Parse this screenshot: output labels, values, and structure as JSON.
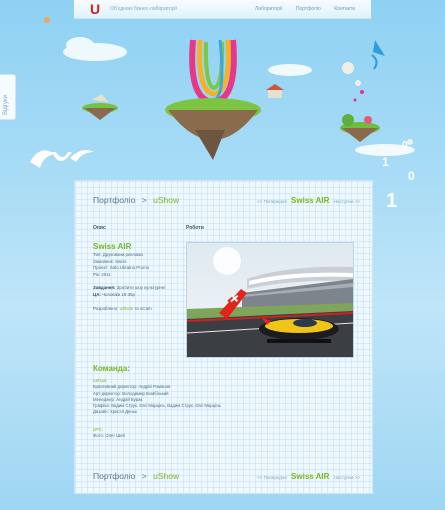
{
  "header": {
    "logo": "U",
    "tagline": "Об'єднані бізнес-лабораторії",
    "nav": [
      "Лабораторії",
      "Портфоліо",
      "Контакти"
    ]
  },
  "side_tab": {
    "label": "Відгуки"
  },
  "breadcrumb": {
    "parent": "Портфоліо",
    "separator": ">",
    "current": "uShow"
  },
  "pager": {
    "prev": "<< Попередня",
    "project": "Swiss AIR",
    "next": "Наступна >>"
  },
  "columns": {
    "description": "Опис",
    "work": "Роботи"
  },
  "project": {
    "title": "Swiss AIR",
    "details": [
      "Тип: Друкована реклама",
      "Замовник: Swiss",
      "Проект: Salo Ukraina Promo",
      "Рік: 2011"
    ],
    "task_label": "Завдання:",
    "task_text": "Зробити шоу культурне!",
    "ca_label": "ЦА:",
    "ca_text": "Чоловіки 18-35р",
    "developed_prefix": "Розроблено:",
    "developed_link": "uShow",
    "developed_suffix": "та uCam"
  },
  "team": {
    "title": "Команда:",
    "group1": "uShow:",
    "members1": [
      "Креативний директор: Андрій Романов",
      "Арт-директор: Володимир Бомбізький",
      "Менеджер: Андрій Бурак",
      "Графіка: Вадим Струк, Євгі Марцінь, Вадим Струк, Євгі Марцінь",
      "Дизайн: Христя Деньк"
    ],
    "group2": "uPG:",
    "members2": [
      "Фото: Олег Шеб"
    ]
  },
  "colors": {
    "accent_green": "#7ab81e",
    "logo_red": "#d61b1b",
    "sky": "#a9dcf6"
  }
}
